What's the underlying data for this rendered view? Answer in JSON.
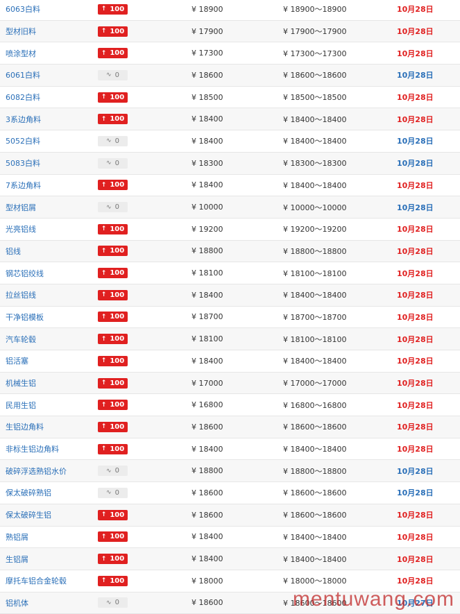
{
  "watermark": "mentuwang.com",
  "colors": {
    "up": "#e02020",
    "flat_date": "#2a6fb8",
    "name": "#2a6fb8"
  },
  "rows": [
    {
      "name": "6063白料",
      "change": "100",
      "dir": "up",
      "price": "¥ 18900",
      "range": "¥ 18900～18900",
      "date": "10月28日"
    },
    {
      "name": "型材旧料",
      "change": "100",
      "dir": "up",
      "price": "¥ 17900",
      "range": "¥ 17900～17900",
      "date": "10月28日"
    },
    {
      "name": "喷涂型材",
      "change": "100",
      "dir": "up",
      "price": "¥ 17300",
      "range": "¥ 17300～17300",
      "date": "10月28日"
    },
    {
      "name": "6061白料",
      "change": "0",
      "dir": "flat",
      "price": "¥ 18600",
      "range": "¥ 18600～18600",
      "date": "10月28日"
    },
    {
      "name": "6082白料",
      "change": "100",
      "dir": "up",
      "price": "¥ 18500",
      "range": "¥ 18500～18500",
      "date": "10月28日"
    },
    {
      "name": "3系边角料",
      "change": "100",
      "dir": "up",
      "price": "¥ 18400",
      "range": "¥ 18400～18400",
      "date": "10月28日"
    },
    {
      "name": "5052白料",
      "change": "0",
      "dir": "flat",
      "price": "¥ 18400",
      "range": "¥ 18400～18400",
      "date": "10月28日"
    },
    {
      "name": "5083白料",
      "change": "0",
      "dir": "flat",
      "price": "¥ 18300",
      "range": "¥ 18300～18300",
      "date": "10月28日"
    },
    {
      "name": "7系边角料",
      "change": "100",
      "dir": "up",
      "price": "¥ 18400",
      "range": "¥ 18400～18400",
      "date": "10月28日"
    },
    {
      "name": "型材铝屑",
      "change": "0",
      "dir": "flat",
      "price": "¥ 10000",
      "range": "¥ 10000～10000",
      "date": "10月28日"
    },
    {
      "name": "光亮铝线",
      "change": "100",
      "dir": "up",
      "price": "¥ 19200",
      "range": "¥ 19200～19200",
      "date": "10月28日"
    },
    {
      "name": "铝线",
      "change": "100",
      "dir": "up",
      "price": "¥ 18800",
      "range": "¥ 18800～18800",
      "date": "10月28日"
    },
    {
      "name": "钢芯铝绞线",
      "change": "100",
      "dir": "up",
      "price": "¥ 18100",
      "range": "¥ 18100～18100",
      "date": "10月28日"
    },
    {
      "name": "拉丝铝线",
      "change": "100",
      "dir": "up",
      "price": "¥ 18400",
      "range": "¥ 18400～18400",
      "date": "10月28日"
    },
    {
      "name": "干净铝模板",
      "change": "100",
      "dir": "up",
      "price": "¥ 18700",
      "range": "¥ 18700～18700",
      "date": "10月28日"
    },
    {
      "name": "汽车轮毂",
      "change": "100",
      "dir": "up",
      "price": "¥ 18100",
      "range": "¥ 18100～18100",
      "date": "10月28日"
    },
    {
      "name": "铝活塞",
      "change": "100",
      "dir": "up",
      "price": "¥ 18400",
      "range": "¥ 18400～18400",
      "date": "10月28日"
    },
    {
      "name": "机械生铝",
      "change": "100",
      "dir": "up",
      "price": "¥ 17000",
      "range": "¥ 17000～17000",
      "date": "10月28日"
    },
    {
      "name": "民用生铝",
      "change": "100",
      "dir": "up",
      "price": "¥ 16800",
      "range": "¥ 16800～16800",
      "date": "10月28日"
    },
    {
      "name": "生铝边角料",
      "change": "100",
      "dir": "up",
      "price": "¥ 18600",
      "range": "¥ 18600～18600",
      "date": "10月28日"
    },
    {
      "name": "非标生铝边角料",
      "change": "100",
      "dir": "up",
      "price": "¥ 18400",
      "range": "¥ 18400～18400",
      "date": "10月28日"
    },
    {
      "name": "破碎浮选熟铝水价",
      "change": "0",
      "dir": "flat",
      "price": "¥ 18800",
      "range": "¥ 18800～18800",
      "date": "10月28日"
    },
    {
      "name": "保太破碎熟铝",
      "change": "0",
      "dir": "flat",
      "price": "¥ 18600",
      "range": "¥ 18600～18600",
      "date": "10月28日"
    },
    {
      "name": "保太破碎生铝",
      "change": "100",
      "dir": "up",
      "price": "¥ 18600",
      "range": "¥ 18600～18600",
      "date": "10月28日"
    },
    {
      "name": "熟铝屑",
      "change": "100",
      "dir": "up",
      "price": "¥ 18400",
      "range": "¥ 18400～18400",
      "date": "10月28日"
    },
    {
      "name": "生铝屑",
      "change": "100",
      "dir": "up",
      "price": "¥ 18400",
      "range": "¥ 18400～18400",
      "date": "10月28日"
    },
    {
      "name": "摩托车铝合金轮毂",
      "change": "100",
      "dir": "up",
      "price": "¥ 18000",
      "range": "¥ 18000～18000",
      "date": "10月28日"
    },
    {
      "name": "铝机体",
      "change": "0",
      "dir": "flat",
      "price": "¥ 18600",
      "range": "¥ 18600～18600",
      "date": "10月27日"
    }
  ]
}
